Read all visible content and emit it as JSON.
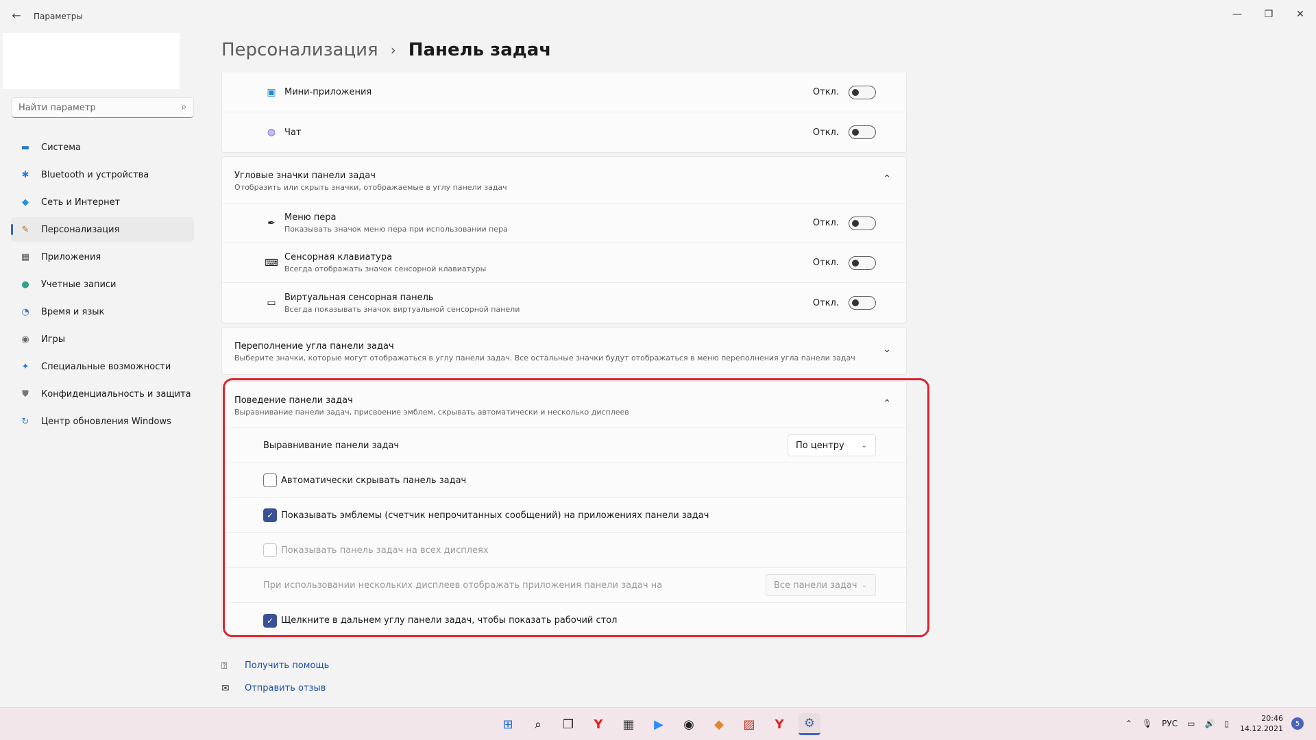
{
  "window": {
    "title": "Параметры",
    "back_icon": "←",
    "minimize_icon": "—",
    "maximize_icon": "❐",
    "close_icon": "✕"
  },
  "search": {
    "placeholder": "Найти параметр",
    "icon": "⌕"
  },
  "nav": {
    "items": [
      {
        "label": "Система",
        "icon": "▬",
        "color": "#2b77c8"
      },
      {
        "label": "Bluetooth и устройства",
        "icon": "✱",
        "color": "#1f7ad9"
      },
      {
        "label": "Сеть и Интернет",
        "icon": "◆",
        "color": "#2b8ad9"
      },
      {
        "label": "Персонализация",
        "icon": "✎",
        "color": "#c96a1e",
        "active": true
      },
      {
        "label": "Приложения",
        "icon": "▦",
        "color": "#555"
      },
      {
        "label": "Учетные записи",
        "icon": "●",
        "color": "#2aa68a"
      },
      {
        "label": "Время и язык",
        "icon": "◔",
        "color": "#2b77c8"
      },
      {
        "label": "Игры",
        "icon": "◉",
        "color": "#666"
      },
      {
        "label": "Специальные возможности",
        "icon": "✦",
        "color": "#2b77c8"
      },
      {
        "label": "Конфиденциальность и защита",
        "icon": "⛊",
        "color": "#777"
      },
      {
        "label": "Центр обновления Windows",
        "icon": "↻",
        "color": "#2b77c8"
      }
    ]
  },
  "header": {
    "parent": "Персонализация",
    "separator": "›",
    "current": "Панель задач"
  },
  "widgets_card": {
    "rows": [
      {
        "title": "Мини-приложения",
        "icon": "▣",
        "state": "Откл."
      },
      {
        "title": "Чат",
        "icon": "◍",
        "state": "Откл."
      }
    ]
  },
  "corner_icons": {
    "title": "Угловые значки панели задач",
    "subtitle": "Отобразить или скрыть значки, отображаемые в углу панели задач",
    "chevron": "⌃",
    "rows": [
      {
        "title": "Меню пера",
        "sub": "Показывать значок меню пера при использовании пера",
        "icon": "✒",
        "state": "Откл."
      },
      {
        "title": "Сенсорная клавиатура",
        "sub": "Всегда отображать значок сенсорной клавиатуры",
        "icon": "⌨",
        "state": "Откл."
      },
      {
        "title": "Виртуальная сенсорная панель",
        "sub": "Всегда показывать значок виртуальной сенсорной панели",
        "icon": "▭",
        "state": "Откл."
      }
    ]
  },
  "overflow": {
    "title": "Переполнение угла панели задач",
    "subtitle": "Выберите значки, которые могут отображаться в углу панели задач. Все остальные значки будут отображаться в меню переполнения угла панели задач",
    "chevron": "⌄"
  },
  "behavior": {
    "title": "Поведение панели задач",
    "subtitle": "Выравнивание панели задач, присвоение эмблем, скрывать автоматически и несколько дисплеев",
    "chevron": "⌃",
    "alignment_label": "Выравнивание панели задач",
    "alignment_value": "По центру",
    "dropdown_chevron": "⌄",
    "check_mark": "✓",
    "autohide_label": "Автоматически скрывать панель задач",
    "badges_label": "Показывать эмблемы (счетчик непрочитанных сообщений) на приложениях панели задач",
    "all_displays_label": "Показывать панель задач на всех дисплеях",
    "multi_display_label": "При использовании нескольких дисплеев отображать приложения панели задач на",
    "multi_display_value": "Все панели задач",
    "corner_click_label": "Щелкните в дальнем углу панели задач, чтобы показать рабочий стол"
  },
  "links": {
    "help": "Получить помощь",
    "help_icon": "⍰",
    "feedback": "Отправить отзыв",
    "feedback_icon": "✉"
  },
  "taskbar": {
    "icons": [
      {
        "name": "start-icon",
        "glyph": "⊞",
        "color": "#1e6fd9"
      },
      {
        "name": "search-icon",
        "glyph": "⌕",
        "color": "#222"
      },
      {
        "name": "task-view-icon",
        "glyph": "❐",
        "color": "#222"
      },
      {
        "name": "yandex-icon",
        "glyph": "Y",
        "color": "#e02020"
      },
      {
        "name": "calculator-icon",
        "glyph": "▦",
        "color": "#444"
      },
      {
        "name": "zoom-icon",
        "glyph": "▶",
        "color": "#2d8cff"
      },
      {
        "name": "obs-icon",
        "glyph": "◉",
        "color": "#222"
      },
      {
        "name": "sublime-icon",
        "glyph": "◆",
        "color": "#e3892d"
      },
      {
        "name": "paint-icon",
        "glyph": "▨",
        "color": "#c0392b"
      },
      {
        "name": "yandex-browser-icon",
        "glyph": "Y",
        "color": "#e02020"
      },
      {
        "name": "settings-icon",
        "glyph": "⚙",
        "color": "#3a63b8",
        "active": true
      }
    ],
    "tray": {
      "chevron": "⌃",
      "mic": "🎙",
      "lang": "РУС",
      "network": "▭",
      "volume": "🔊",
      "battery": "▯",
      "time": "20:46",
      "date": "14.12.2021",
      "notifications": "5"
    }
  }
}
